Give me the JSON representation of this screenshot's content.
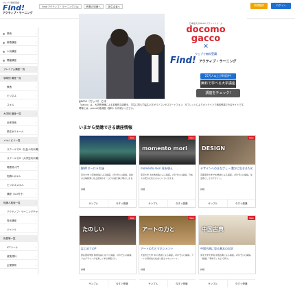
{
  "header": {
    "logo_tag": "ウェブで無料受講",
    "logo_main": "Find!",
    "logo_sub": "アクティブ・ラーニング",
    "tabs": [
      "Find!アクティブ・ラーニングとは",
      "教養の知識へ",
      "新生活者へ"
    ],
    "register_label": "新規登録",
    "login_label": "ログイン"
  },
  "sidebar": {
    "items": [
      {
        "label": "検索",
        "type": "item"
      },
      {
        "label": "新着講座",
        "type": "item"
      },
      {
        "label": "人気講座",
        "type": "item"
      },
      {
        "label": "開催講座",
        "type": "item"
      },
      {
        "label": "プレミアム講座一覧",
        "type": "section"
      },
      {
        "label": "領域別 講座一覧",
        "type": "section"
      },
      {
        "label": "教養",
        "type": "sub"
      },
      {
        "label": "ビジネス",
        "type": "sub"
      },
      {
        "label": "スキル",
        "type": "sub"
      },
      {
        "label": "大学別 講座一覧",
        "type": "section"
      },
      {
        "label": "全体検索",
        "type": "sub"
      },
      {
        "label": "慶応ゼミナール",
        "type": "sub"
      },
      {
        "label": "メキシビド一覧",
        "type": "section"
      },
      {
        "label": "スクールでM（社会人向け講座）",
        "type": "sub"
      },
      {
        "label": "スクールでM（大学生向け講座）",
        "type": "sub"
      },
      {
        "label": "再履修入門",
        "type": "sub"
      },
      {
        "label": "知識×スキル",
        "type": "sub"
      },
      {
        "label": "ビジネススキル",
        "type": "sub"
      },
      {
        "label": "講座（ALI付き）",
        "type": "sub"
      },
      {
        "label": "知識人検索一覧",
        "type": "section"
      },
      {
        "label": "アクティブ・ラーニングチャーゼ",
        "type": "sub"
      },
      {
        "label": "特化講座",
        "type": "sub"
      },
      {
        "label": "ジャンル",
        "type": "sub"
      },
      {
        "label": "所属等一覧",
        "type": "section"
      },
      {
        "label": "ICTツール",
        "type": "sub"
      },
      {
        "label": "政策資料",
        "type": "sub"
      },
      {
        "label": "企業教育",
        "type": "sub"
      }
    ]
  },
  "hero": {
    "tag": "日本最大のMOOCプラットフォーム",
    "docomo": "docomo",
    "gacco": "gacco",
    "cross": "×",
    "find_tag": "ウェブで無料受講",
    "find": "Find!",
    "find_sub": "アクティブ・ラーニング",
    "badge": "25万人以上が利用中!",
    "banner": "無料で学べる大学講座",
    "cta": "講座をチェック!"
  },
  "caption": "gacco（ガッコ）とは",
  "description": "「gacco」は、大学教授陣による本格的な講義を、学生に限らず幅広い方がパソコンやスマートフォン、タブレットによりオンラインで無料受講できるサイトです。現場には、gaccoの各講座（無料）がお使いください。",
  "section_title": "いまから受講できる講座情報",
  "courses": [
    {
      "title": "解明!オーロラの謎",
      "img_text": "",
      "desc": "東北大学 小原教授等による講座。2月7日(火)開講。最新の太陽観測と地上観測のオーロラの謎を解き明かします。",
      "date": "詳細",
      "left": "サンプル",
      "right": "今すぐ受講",
      "new": "New"
    },
    {
      "title": "momento mori 死を想え",
      "img_text": "momento mori",
      "desc": "東京大学 清水教授等による講座。2月7日(火)開講。日本人の死の文化をひもといていきます。",
      "date": "詳細",
      "left": "サンプル",
      "right": "今すぐ受講",
      "new": "New"
    },
    {
      "title": "デザインへのまなざし ─ 豊かに生きるための思考法",
      "img_text": "DESIGN",
      "desc": "京都造形大学 竹村教授による講座。2月7日(火)開講。生活者としてのデザイン。",
      "date": "詳細",
      "left": "サンプル",
      "right": "今すぐ受講",
      "new": "New"
    },
    {
      "title": "はじめてのP",
      "img_text": "たのしい",
      "desc": "慶応義塾学部 教授協議に基づく講座。2月7日(火)開講。プログラミングを楽しく学ぶ講座です。",
      "date": "詳細",
      "left": "サンプル",
      "right": "今すぐ受講",
      "new": "New"
    },
    {
      "title": "アートの力とマネジメント",
      "img_text": "アートの力と",
      "desc": "大阪市立大学 中川 教授による講座。2月7日(火)開講。アートの持続性を社会と結ぶマネジメント。",
      "date": "詳細",
      "left": "サンプル",
      "right": "今すぐ受講",
      "new": "New"
    },
    {
      "title": "中国古典に見る基本の自学",
      "img_text": "中国古典",
      "desc": "東北大学大学院 中国古典による講座。2月7日(火)開講。「論語」「韓非子」などで学ぶ。",
      "date": "詳細",
      "left": "サンプル",
      "right": "今すぐ受講",
      "new": "New"
    }
  ]
}
